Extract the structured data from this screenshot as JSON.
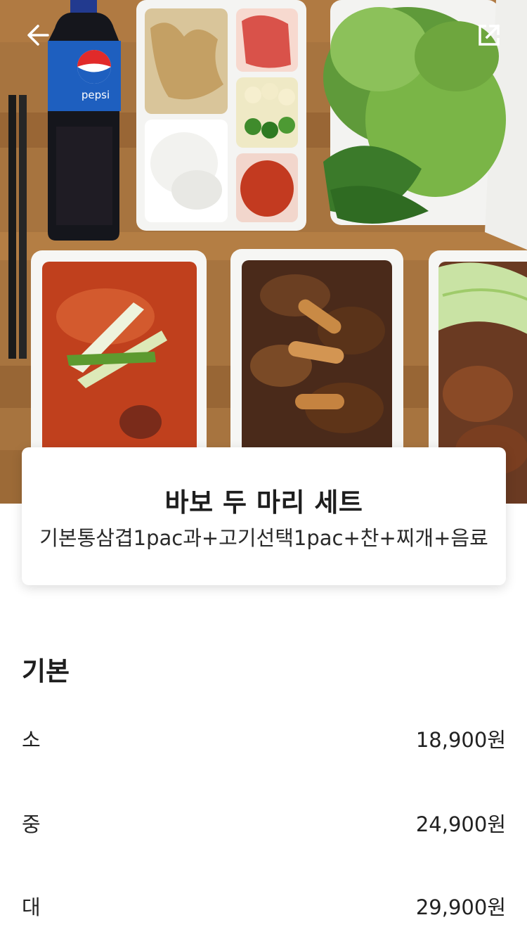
{
  "menu": {
    "title": "바보 두 마리 세트",
    "description": "기본통삼겹1pac과+고기선택1pac+찬+찌개+음료"
  },
  "hero": {
    "bottle_label": "pepsi"
  },
  "icons": {
    "back": "arrow-left-icon",
    "share": "external-link-icon"
  },
  "options": {
    "section_title": "기본",
    "items": [
      {
        "name": "소",
        "price": "18,900원"
      },
      {
        "name": "중",
        "price": "24,900원"
      },
      {
        "name": "대",
        "price": "29,900원"
      }
    ]
  }
}
